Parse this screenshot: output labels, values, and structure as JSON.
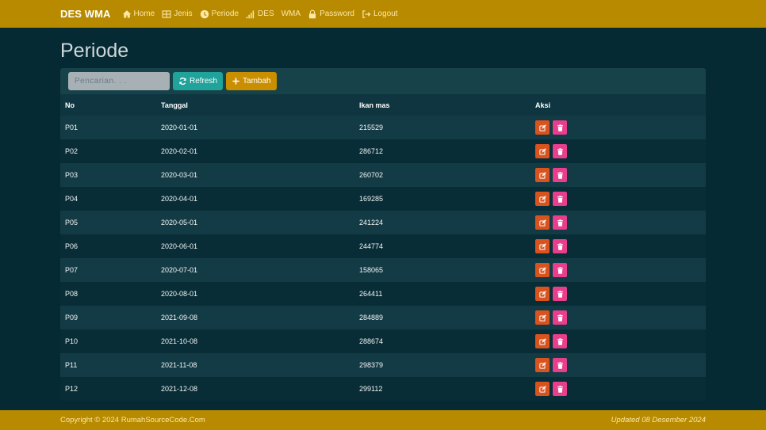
{
  "navbar": {
    "brand": "DES WMA",
    "items": [
      {
        "label": "Home",
        "icon": "home-icon"
      },
      {
        "label": "Jenis",
        "icon": "table-icon"
      },
      {
        "label": "Periode",
        "icon": "clock-icon"
      },
      {
        "label": "DES",
        "icon": "signal-icon"
      },
      {
        "label": "WMA",
        "icon": ""
      },
      {
        "label": "Password",
        "icon": "lock-icon"
      },
      {
        "label": "Logout",
        "icon": "logout-icon"
      }
    ]
  },
  "page": {
    "title": "Periode"
  },
  "toolbar": {
    "search_placeholder": "Pencarian. . .",
    "refresh_label": "Refresh",
    "tambah_label": "Tambah"
  },
  "table": {
    "headers": [
      "No",
      "Tanggal",
      "Ikan mas",
      "Aksi"
    ],
    "rows": [
      {
        "no": "P01",
        "tanggal": "2020-01-01",
        "ikan_mas": "215529"
      },
      {
        "no": "P02",
        "tanggal": "2020-02-01",
        "ikan_mas": "286712"
      },
      {
        "no": "P03",
        "tanggal": "2020-03-01",
        "ikan_mas": "260702"
      },
      {
        "no": "P04",
        "tanggal": "2020-04-01",
        "ikan_mas": "169285"
      },
      {
        "no": "P05",
        "tanggal": "2020-05-01",
        "ikan_mas": "241224"
      },
      {
        "no": "P06",
        "tanggal": "2020-06-01",
        "ikan_mas": "244774"
      },
      {
        "no": "P07",
        "tanggal": "2020-07-01",
        "ikan_mas": "158065"
      },
      {
        "no": "P08",
        "tanggal": "2020-08-01",
        "ikan_mas": "264411"
      },
      {
        "no": "P09",
        "tanggal": "2021-09-08",
        "ikan_mas": "284889"
      },
      {
        "no": "P10",
        "tanggal": "2021-10-08",
        "ikan_mas": "288674"
      },
      {
        "no": "P11",
        "tanggal": "2021-11-08",
        "ikan_mas": "298379"
      },
      {
        "no": "P12",
        "tanggal": "2021-12-08",
        "ikan_mas": "299112"
      }
    ]
  },
  "footer": {
    "copyright": "Copyright © 2024 RumahSourceCode.Com",
    "updated": "Updated 08 Desember 2024"
  },
  "colors": {
    "navbar": "#b78a00",
    "background": "#062a33",
    "refresh": "#1fa39a",
    "tambah": "#c98f00",
    "edit": "#d9531e",
    "delete": "#e83e8c"
  }
}
